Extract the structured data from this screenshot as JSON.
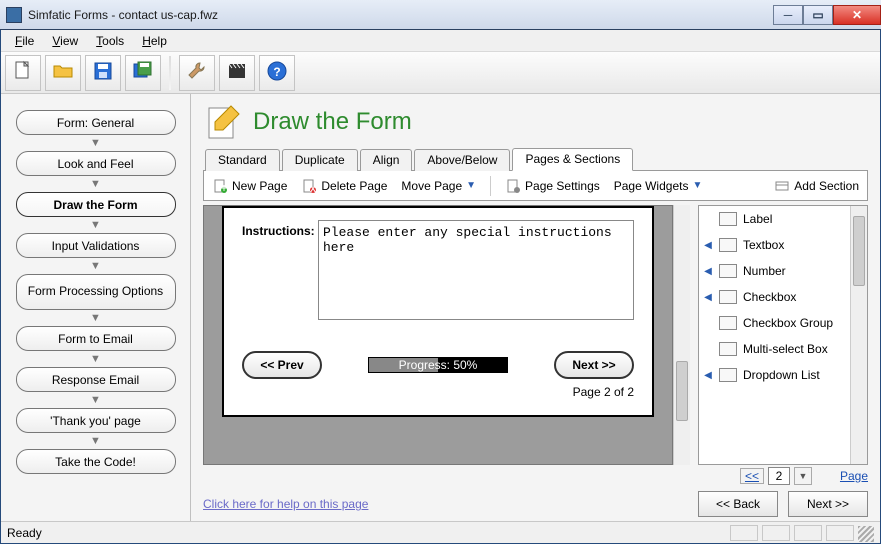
{
  "window": {
    "title": "Simfatic Forms - contact us-cap.fwz"
  },
  "menu": {
    "items": [
      "File",
      "View",
      "Tools",
      "Help"
    ]
  },
  "toolbar_icons": [
    "new-file-icon",
    "open-folder-icon",
    "save-icon",
    "save-all-icon",
    "settings-wrench-icon",
    "clapper-icon",
    "help-icon"
  ],
  "sidebar": {
    "steps": [
      {
        "label": "Form: General",
        "active": false
      },
      {
        "label": "Look and Feel",
        "active": false
      },
      {
        "label": "Draw the Form",
        "active": true
      },
      {
        "label": "Input Validations",
        "active": false
      },
      {
        "label": "Form Processing Options",
        "active": false,
        "twoline": true
      },
      {
        "label": "Form to Email",
        "active": false
      },
      {
        "label": "Response Email",
        "active": false
      },
      {
        "label": "'Thank you' page",
        "active": false
      },
      {
        "label": "Take the Code!",
        "active": false
      }
    ]
  },
  "page": {
    "title": "Draw the Form"
  },
  "tabs": [
    {
      "label": "Standard",
      "active": false
    },
    {
      "label": "Duplicate",
      "active": false
    },
    {
      "label": "Align",
      "active": false
    },
    {
      "label": "Above/Below",
      "active": false
    },
    {
      "label": "Pages & Sections",
      "active": true
    }
  ],
  "tab_toolbar": {
    "new_page": "New Page",
    "delete_page": "Delete Page",
    "move_page": "Move Page",
    "page_settings": "Page Settings",
    "page_widgets": "Page Widgets",
    "add_section": "Add Section"
  },
  "canvas": {
    "instructions_label": "Instructions:",
    "instructions_value": "Please enter any special instructions here",
    "prev_label": "<< Prev",
    "next_label": "Next >>",
    "progress_label": "Progress: 50%",
    "progress_percent": 50,
    "page_counter": "Page 2 of 2"
  },
  "palette": {
    "items": [
      {
        "label": "Label",
        "expandable": false
      },
      {
        "label": "Textbox",
        "expandable": true
      },
      {
        "label": "Number",
        "expandable": true
      },
      {
        "label": "Checkbox",
        "expandable": true
      },
      {
        "label": "Checkbox Group",
        "expandable": false
      },
      {
        "label": "Multi-select Box",
        "expandable": false
      },
      {
        "label": "Dropdown List",
        "expandable": true
      }
    ]
  },
  "pager": {
    "prev_symbol": "<<",
    "current": "2",
    "page_link": "Page"
  },
  "footer": {
    "help_link": "Click here for help on this page",
    "back": "<< Back",
    "next": "Next >>"
  },
  "status": {
    "text": "Ready"
  }
}
